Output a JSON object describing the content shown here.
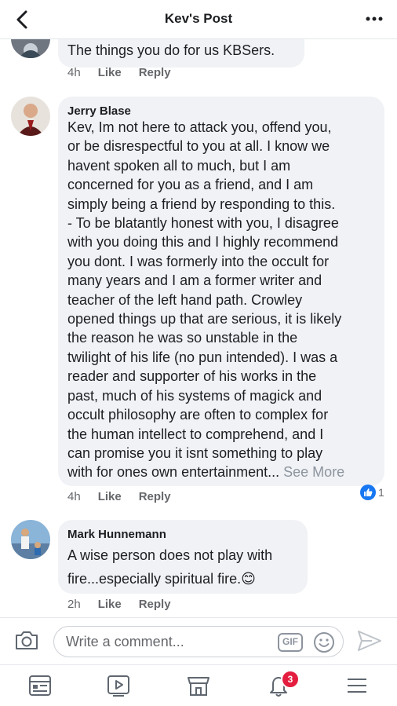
{
  "header": {
    "title": "Kev's Post",
    "back_icon": "chevron-left-icon",
    "more_icon": "more-horizontal-icon"
  },
  "comments": [
    {
      "text": "The things you do for us KBSers.",
      "time": "4h",
      "like_label": "Like",
      "reply_label": "Reply"
    },
    {
      "author": "Jerry Blase",
      "lines": [
        "Kev, Im not here to attack you, offend you,",
        "or be disrespectful to you at all. I know we",
        "havent spoken all to much, but I am",
        "concerned for you as a friend, and I am",
        "simply being a friend by responding to this.",
        "- To be blatantly honest with you, I disagree",
        "with you doing this and I highly recommend",
        "you dont. I was formerly into the occult for",
        "many years and I am a former writer and",
        "teacher of the left hand path. Crowley",
        "opened things up that are serious, it is likely",
        "the reason he was so unstable in the",
        "twilight of his life (no pun intended). I was a",
        "reader and supporter of his works in the",
        "past, much of his systems of magick and",
        "occult philosophy are often to complex for",
        "the human intellect to comprehend, and I",
        "can promise you it isnt something to play"
      ],
      "last_line": "with for ones own entertainment...",
      "see_more": "See More",
      "time": "4h",
      "like_label": "Like",
      "reply_label": "Reply",
      "reaction_icon": "thumbs-up-icon",
      "reaction_count": "1"
    },
    {
      "author": "Mark Hunnemann",
      "lines": [
        "A wise person does not play with",
        "fire...especially spiritual fire.😊"
      ],
      "time": "2h",
      "like_label": "Like",
      "reply_label": "Reply"
    }
  ],
  "composer": {
    "placeholder": "Write a comment...",
    "gif_label": "GIF",
    "camera_icon": "camera-icon",
    "emoji_icon": "emoji-icon",
    "send_icon": "send-icon"
  },
  "tabbar": {
    "items": [
      "news-feed-icon",
      "watch-icon",
      "marketplace-icon",
      "notifications-icon",
      "menu-icon"
    ],
    "notification_count": "3"
  },
  "colors": {
    "accent": "#1877f2",
    "bubble": "#f0f2f5",
    "badge": "#e41e3f",
    "meta_text": "#65676b"
  }
}
